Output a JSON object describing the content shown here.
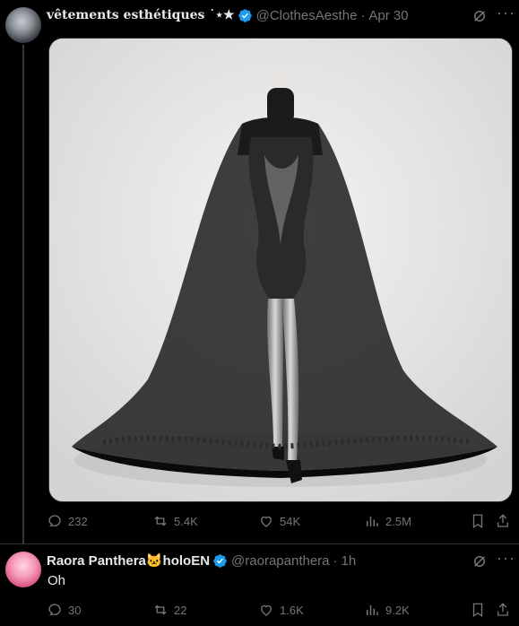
{
  "tweet": {
    "display_name": "vêtements esthétiques ˙⋆★",
    "handle": "@ClothesAesthe",
    "sep": "·",
    "time": "Apr 30",
    "stats": {
      "replies": "232",
      "reposts": "5.4K",
      "likes": "54K",
      "views": "2.5M"
    }
  },
  "reply": {
    "display_name": "Raora Panthera🐱holoEN",
    "handle": "@raorapanthera",
    "sep": "·",
    "time": "1h",
    "text": "Oh",
    "stats": {
      "replies": "30",
      "reposts": "22",
      "likes": "1.6K",
      "views": "9.2K"
    }
  },
  "icons": [
    "verified-badge-icon",
    "grok-icon",
    "more-icon",
    "reply-icon",
    "repost-icon",
    "like-icon",
    "views-icon",
    "bookmark-icon",
    "share-icon"
  ],
  "colors": {
    "background": "#000000",
    "text": "#e7e9ea",
    "muted": "#71767b",
    "verified": "#1d9bf0",
    "divider": "#2f3336"
  }
}
